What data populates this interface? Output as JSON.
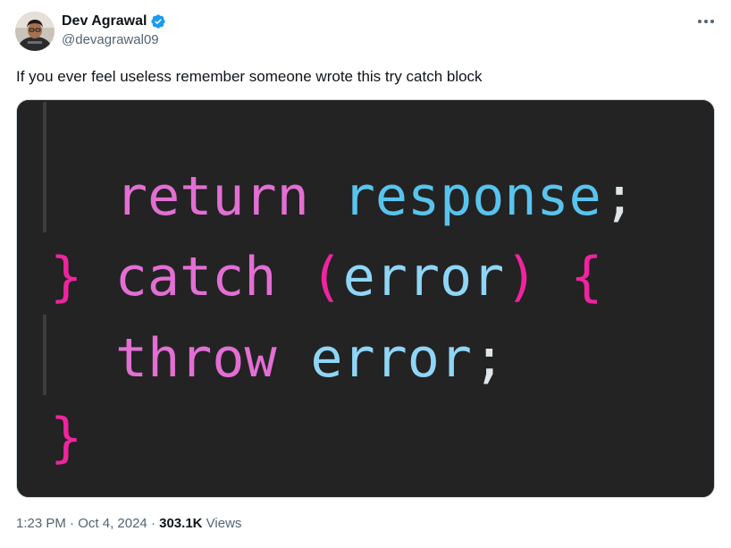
{
  "author": {
    "display_name": "Dev Agrawal",
    "handle": "@devagrawal09",
    "verified": true,
    "avatar_icon": "avatar-photo"
  },
  "menu": {
    "icon": "more-icon"
  },
  "tweet": {
    "text": "If you ever feel useless remember someone wrote this try catch block"
  },
  "media": {
    "code_lines": [
      {
        "tokens": [
          {
            "text": "return",
            "color": "#e26fd3"
          },
          {
            "text": "response",
            "color": "#58c4ee"
          },
          {
            "text": ";",
            "color": "#dfe6ea"
          }
        ]
      },
      {
        "tokens": [
          {
            "text": "}",
            "color": "#f0249f"
          },
          {
            "text": "catch",
            "color": "#e26fd3"
          },
          {
            "text": "(",
            "color": "#f0249f"
          },
          {
            "text": "error",
            "color": "#8fd6f6"
          },
          {
            "text": ")",
            "color": "#f0249f"
          },
          {
            "text": "{",
            "color": "#f0249f"
          }
        ]
      },
      {
        "tokens": [
          {
            "text": "throw",
            "color": "#e26fd3"
          },
          {
            "text": "error",
            "color": "#8fd6f6"
          },
          {
            "text": ";",
            "color": "#dfe6ea"
          }
        ]
      },
      {
        "tokens": [
          {
            "text": "}",
            "color": "#f0249f"
          }
        ]
      }
    ],
    "background": "#232323"
  },
  "meta": {
    "time": "1:23 PM",
    "separator": "·",
    "date": "Oct 4, 2024",
    "views_count": "303.1K",
    "views_label": "Views"
  },
  "colors": {
    "text": "#0f1419",
    "secondary": "#536471",
    "verified_blue": "#1d9bf0"
  }
}
